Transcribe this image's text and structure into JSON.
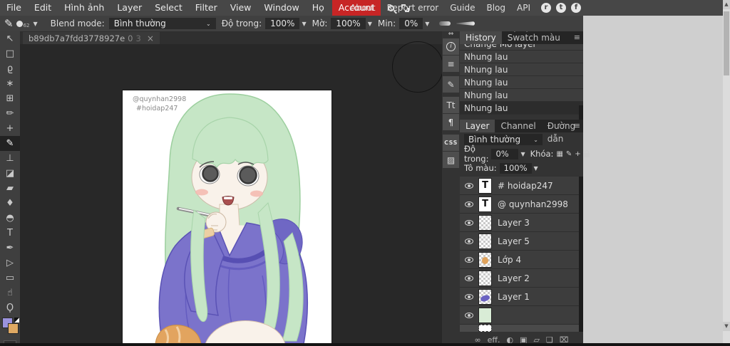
{
  "colors": {
    "accent_red": "#c72525",
    "foreground_swatch": "#9b93dd",
    "background_swatch": "#dfa963",
    "hair_green": "#c6e6c6",
    "hoodie_purple": "#7b73cb"
  },
  "menu_bar": {
    "items": [
      "File",
      "Edit",
      "Hình ảnh",
      "Layer",
      "Select",
      "Filter",
      "View",
      "Window",
      "Họ"
    ],
    "account_label": "Account",
    "links": [
      "About",
      "Report error",
      "Guide",
      "Blog",
      "API"
    ],
    "social": [
      "r",
      "t",
      "f"
    ]
  },
  "options_bar": {
    "brush_size": "62",
    "blend_label": "Blend mode:",
    "blend_value": "Bình thường",
    "opacity_label": "Độ trong:",
    "opacity_value": "100%",
    "soft_label": "Mờ:",
    "soft_value": "100%",
    "min_label": "Min:",
    "min_value": "0%",
    "caret": "▼",
    "chevron": "⌄"
  },
  "document_tab": {
    "title": "b89db7a7fdd3778927e",
    "number": "0",
    "dim_number": "3",
    "close": "×"
  },
  "tools": [
    {
      "name": "move-tool",
      "glyph": "↖"
    },
    {
      "name": "marquee-tool",
      "glyph": "□"
    },
    {
      "name": "lasso-tool",
      "glyph": "ϱ"
    },
    {
      "name": "magic-wand-tool",
      "glyph": "∗"
    },
    {
      "name": "crop-tool",
      "glyph": "⊞"
    },
    {
      "name": "eyedropper-tool",
      "glyph": "✏"
    },
    {
      "name": "healing-tool",
      "glyph": "+"
    },
    {
      "name": "brush-tool",
      "glyph": "✎"
    },
    {
      "name": "clone-stamp-tool",
      "glyph": "⊥"
    },
    {
      "name": "eraser-tool",
      "glyph": "◪"
    },
    {
      "name": "gradient-tool",
      "glyph": "▰"
    },
    {
      "name": "blur-tool",
      "glyph": "♦"
    },
    {
      "name": "dodge-tool",
      "glyph": "◓"
    },
    {
      "name": "type-tool",
      "glyph": "T"
    },
    {
      "name": "pen-tool",
      "glyph": "✒"
    },
    {
      "name": "path-select-tool",
      "glyph": "▷"
    },
    {
      "name": "shape-tool",
      "glyph": "▭"
    },
    {
      "name": "hand-tool",
      "glyph": "☝"
    },
    {
      "name": "zoom-tool",
      "glyph": "Ϙ"
    }
  ],
  "canvas": {
    "credit_line1": "@quynhan2998",
    "credit_line2": "#hoidap247"
  },
  "right_strip": {
    "collapse": "⇔",
    "buttons": [
      {
        "name": "info-panel-icon",
        "glyph": "i"
      },
      {
        "name": "adjustments-panel-icon",
        "glyph": "≡"
      },
      {
        "name": "brush-settings-panel-icon",
        "glyph": "✎"
      },
      {
        "name": "character-panel-icon",
        "glyph": "Tt"
      },
      {
        "name": "paragraph-panel-icon",
        "glyph": "¶"
      },
      {
        "name": "css-panel-icon",
        "glyph": "CSS"
      },
      {
        "name": "image-panel-icon",
        "glyph": "▨"
      }
    ]
  },
  "history_panel": {
    "collapse_arrows": "> <",
    "tab_history": "History",
    "tab_swatches": "Swatch màu",
    "menu_glyph": "≡",
    "items": [
      "Change Mờ layer",
      "Nhung lau",
      "Nhung lau",
      "Nhung lau",
      "Nhung lau",
      "Nhung lau"
    ]
  },
  "layers_panel": {
    "tab_layer": "Layer",
    "tab_channel": "Channel",
    "tab_paths": "Đường dẫn",
    "menu_glyph": "≡",
    "blend_value": "Bình thường",
    "blend_chevron": "⌄",
    "opacity_label": "Độ trong:",
    "opacity_value": "0%",
    "lock_label": "Khóa:",
    "lock_icons": [
      "▦",
      "✎",
      "+"
    ],
    "fill_label": "Tô màu:",
    "fill_value": "100%",
    "caret": "▼",
    "layers": [
      {
        "name": "# hoidap247",
        "thumb": "text"
      },
      {
        "name": "@ quynhan2998",
        "thumb": "text"
      },
      {
        "name": "Layer 3",
        "thumb": "checker"
      },
      {
        "name": "Layer 5",
        "thumb": "checker"
      },
      {
        "name": "Lớp 4",
        "thumb": "checker-orange"
      },
      {
        "name": "Layer 2",
        "thumb": "checker"
      },
      {
        "name": "Layer 1",
        "thumb": "checker-purple"
      },
      {
        "name": "",
        "thumb": "green"
      }
    ],
    "text_thumb_glyph": "T",
    "bottom_icons": [
      {
        "name": "link-layers-icon",
        "glyph": "∞"
      },
      {
        "name": "layer-effects-icon",
        "glyph": "eff."
      },
      {
        "name": "adjustment-layer-icon",
        "glyph": "◐"
      },
      {
        "name": "layer-mask-icon",
        "glyph": "▣"
      },
      {
        "name": "group-folder-icon",
        "glyph": "▱"
      },
      {
        "name": "new-layer-icon",
        "glyph": "❏"
      },
      {
        "name": "delete-layer-icon",
        "glyph": "⌧"
      }
    ]
  },
  "scrollbar": {
    "up": "▲",
    "down": "▼"
  }
}
